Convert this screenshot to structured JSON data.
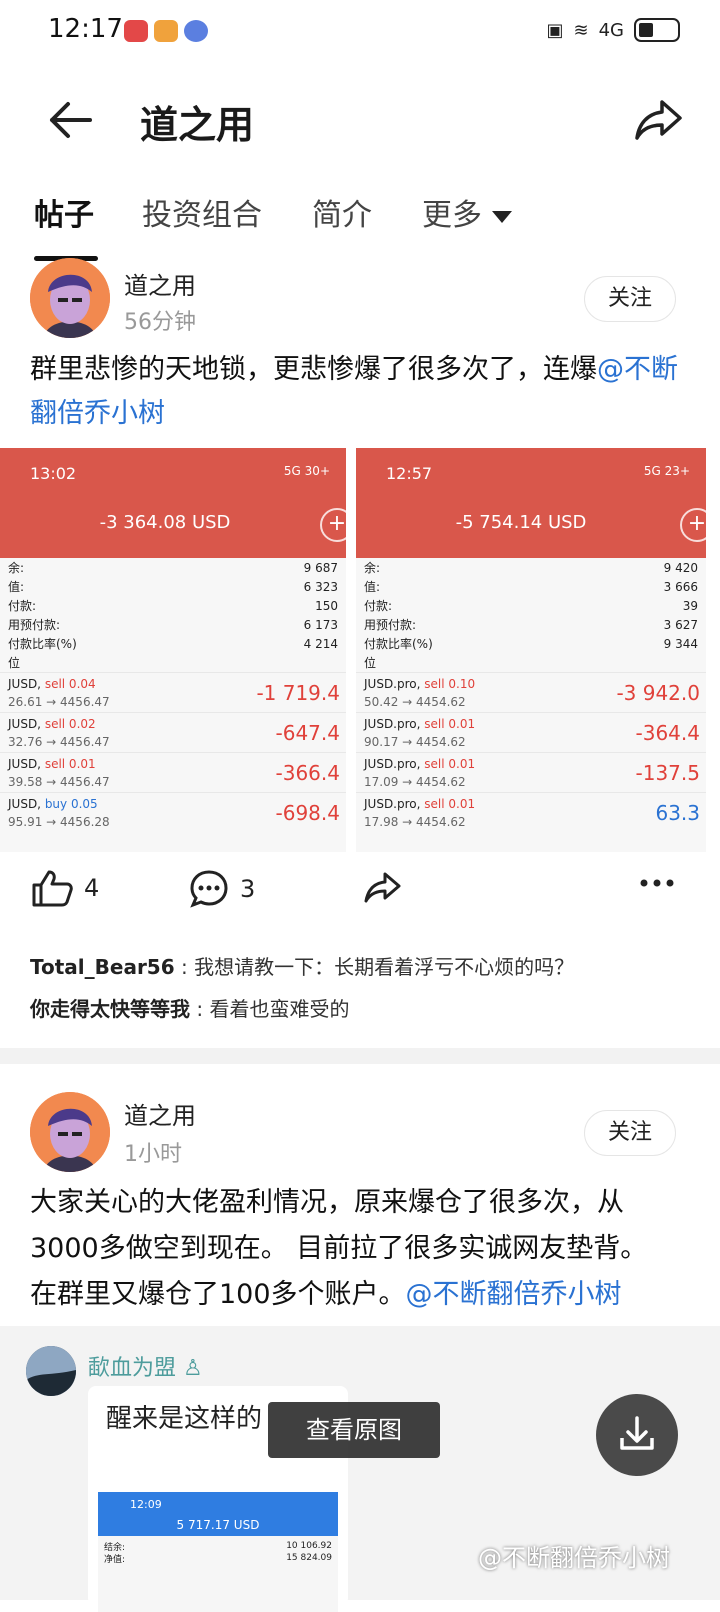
{
  "status": {
    "time": "12:17",
    "signal": "4G"
  },
  "header": {
    "title": "道之用"
  },
  "tabs": [
    {
      "label": "帖子"
    },
    {
      "label": "投资组合"
    },
    {
      "label": "简介"
    },
    {
      "label": "更多"
    }
  ],
  "post1": {
    "author": "道之用",
    "time": "56分钟",
    "follow": "关注",
    "text": "群里悲惨的天地锁，更悲惨爆了很多次了，连爆",
    "mention": "@不断翻倍乔小树",
    "likes": "4",
    "comments_count": "3",
    "shot1": {
      "time": "13:02",
      "signal": "5G 30+",
      "amount": "-3 364.08 USD",
      "rows": [
        [
          "余:",
          "9 687"
        ],
        [
          "值:",
          "6 323"
        ],
        [
          "付款:",
          "150"
        ],
        [
          "用预付款:",
          "6 173"
        ],
        [
          "付款比率(%)",
          "4 214"
        ],
        [
          "位",
          ""
        ]
      ],
      "positions": [
        {
          "sym": "JUSD, ",
          "side": "sell 0.04",
          "type": "sell",
          "range": "26.61 → 4456.47",
          "pnl": "-1 719.4"
        },
        {
          "sym": "JUSD, ",
          "side": "sell 0.02",
          "type": "sell",
          "range": "32.76 → 4456.47",
          "pnl": "-647.4"
        },
        {
          "sym": "JUSD, ",
          "side": "sell 0.01",
          "type": "sell",
          "range": "39.58 → 4456.47",
          "pnl": "-366.4"
        },
        {
          "sym": "JUSD, ",
          "side": "buy 0.05",
          "type": "buy",
          "range": "95.91 → 4456.28",
          "pnl": "-698.4"
        }
      ]
    },
    "shot2": {
      "time": "12:57",
      "signal": "5G 23+",
      "amount": "-5 754.14 USD",
      "rows": [
        [
          "余:",
          "9 420"
        ],
        [
          "值:",
          "3 666"
        ],
        [
          "付款:",
          "39"
        ],
        [
          "用预付款:",
          "3 627"
        ],
        [
          "付款比率(%)",
          "9 344"
        ],
        [
          "位",
          ""
        ]
      ],
      "positions": [
        {
          "sym": "JUSD.pro, ",
          "side": "sell 0.10",
          "type": "sell",
          "range": "50.42 → 4454.62",
          "pnl": "-3 942.0"
        },
        {
          "sym": "JUSD.pro, ",
          "side": "sell 0.01",
          "type": "sell",
          "range": "90.17 → 4454.62",
          "pnl": "-364.4"
        },
        {
          "sym": "JUSD.pro, ",
          "side": "sell 0.01",
          "type": "sell",
          "range": "17.09 → 4454.62",
          "pnl": "-137.5"
        },
        {
          "sym": "JUSD.pro, ",
          "side": "sell 0.01",
          "type": "sell",
          "range": "17.98 → 4454.62",
          "pnl": "63.3",
          "positive": true
        }
      ]
    },
    "comments": [
      {
        "user": "Total_Bear56",
        "text": "我想请教一下：长期看着浮亏不心烦的吗？"
      },
      {
        "user": "你走得太快等等我",
        "text": "看着也蛮难受的"
      }
    ]
  },
  "post2": {
    "author": "道之用",
    "time": "1小时",
    "follow": "关注",
    "line1": "大家关心的大佬盈利情况，原来爆仓了很多次，从",
    "line2": "3000多做空到现在。 目前拉了很多实诚网友垫背。",
    "line3": "在群里又爆仓了100多个账户。",
    "mention": "@不断翻倍乔小树"
  },
  "quote": {
    "user": "歃血为盟",
    "text": "醒来是这样的",
    "phone_time": "12:09",
    "phone_amount": "5 717.17 USD",
    "phone_rows": [
      [
        "结余:",
        "10 106.92"
      ],
      [
        "净值:",
        "15 824.09"
      ]
    ]
  },
  "overlay": {
    "view_original": "查看原图",
    "watermark": "@不断翻倍乔小树"
  },
  "colors": {
    "accent_red": "#d9574b",
    "mention_blue": "#2a72d2",
    "quote_name": "#4d9c9c"
  }
}
